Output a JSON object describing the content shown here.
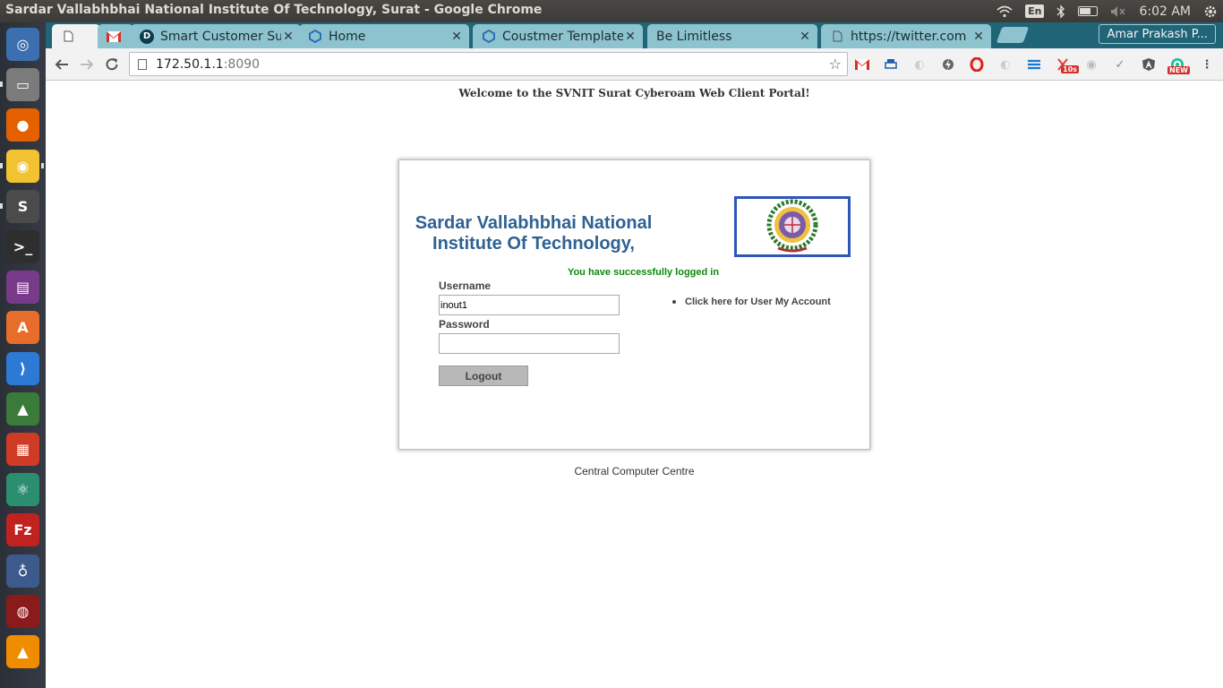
{
  "system": {
    "window_title": "Sardar Vallabhbhai National Institute Of Technology, Surat - Google Chrome",
    "keyboard_lang": "En",
    "clock": "6:02 AM"
  },
  "launcher": {
    "apps": [
      {
        "name": "ubuntu-dash",
        "color": "#3c6fb0"
      },
      {
        "name": "files",
        "color": "#7b7b7b"
      },
      {
        "name": "firefox",
        "color": "#e66000"
      },
      {
        "name": "chrome",
        "color": "#f2c230"
      },
      {
        "name": "sublime-text",
        "color": "#4b4b4b"
      },
      {
        "name": "terminal",
        "color": "#2e2e2e"
      },
      {
        "name": "media-player",
        "color": "#7a3a8a"
      },
      {
        "name": "software-center",
        "color": "#e86c2a"
      },
      {
        "name": "vs-code",
        "color": "#2c7ad6"
      },
      {
        "name": "android-studio",
        "color": "#3a7a3a"
      },
      {
        "name": "windows-app",
        "color": "#cf3b24"
      },
      {
        "name": "atom",
        "color": "#2b8f6f"
      },
      {
        "name": "filezilla",
        "color": "#c0231f"
      },
      {
        "name": "pgadmin",
        "color": "#3c5b8c"
      },
      {
        "name": "red-app",
        "color": "#8b1a1a"
      },
      {
        "name": "vlc",
        "color": "#f08c00"
      }
    ]
  },
  "tabs": [
    {
      "label": "",
      "favicon": "page-icon",
      "active": true
    },
    {
      "label": "",
      "favicon": "gmail-icon",
      "active": false
    },
    {
      "label": "Smart Customer Su",
      "favicon": "d-icon",
      "active": false
    },
    {
      "label": "Home",
      "favicon": "hex-icon",
      "active": false
    },
    {
      "label": "Coustmer Template",
      "favicon": "hex-icon",
      "active": false
    },
    {
      "label": "Be Limitless",
      "favicon": "",
      "active": false
    },
    {
      "label": "https://twitter.com",
      "favicon": "page-icon",
      "active": false
    }
  ],
  "profile_name": "Amar Prakash P...",
  "address_bar": {
    "host": "172.50.1.1",
    "port": ":8090"
  },
  "extensions": {
    "badge_10s": "10s",
    "badge_new": "NEW"
  },
  "page": {
    "welcome": "Welcome to the SVNIT Surat Cyberoam Web Client Portal!",
    "institute_line1": "Sardar Vallabhbhai National",
    "institute_line2": "Institute Of Technology,",
    "status_message": "You have successfully logged in",
    "username_label": "Username",
    "username_value": "inout1",
    "password_label": "Password",
    "password_value": "",
    "logout_label": "Logout",
    "account_link": "Click here for User My Account",
    "footer": "Central Computer Centre"
  }
}
